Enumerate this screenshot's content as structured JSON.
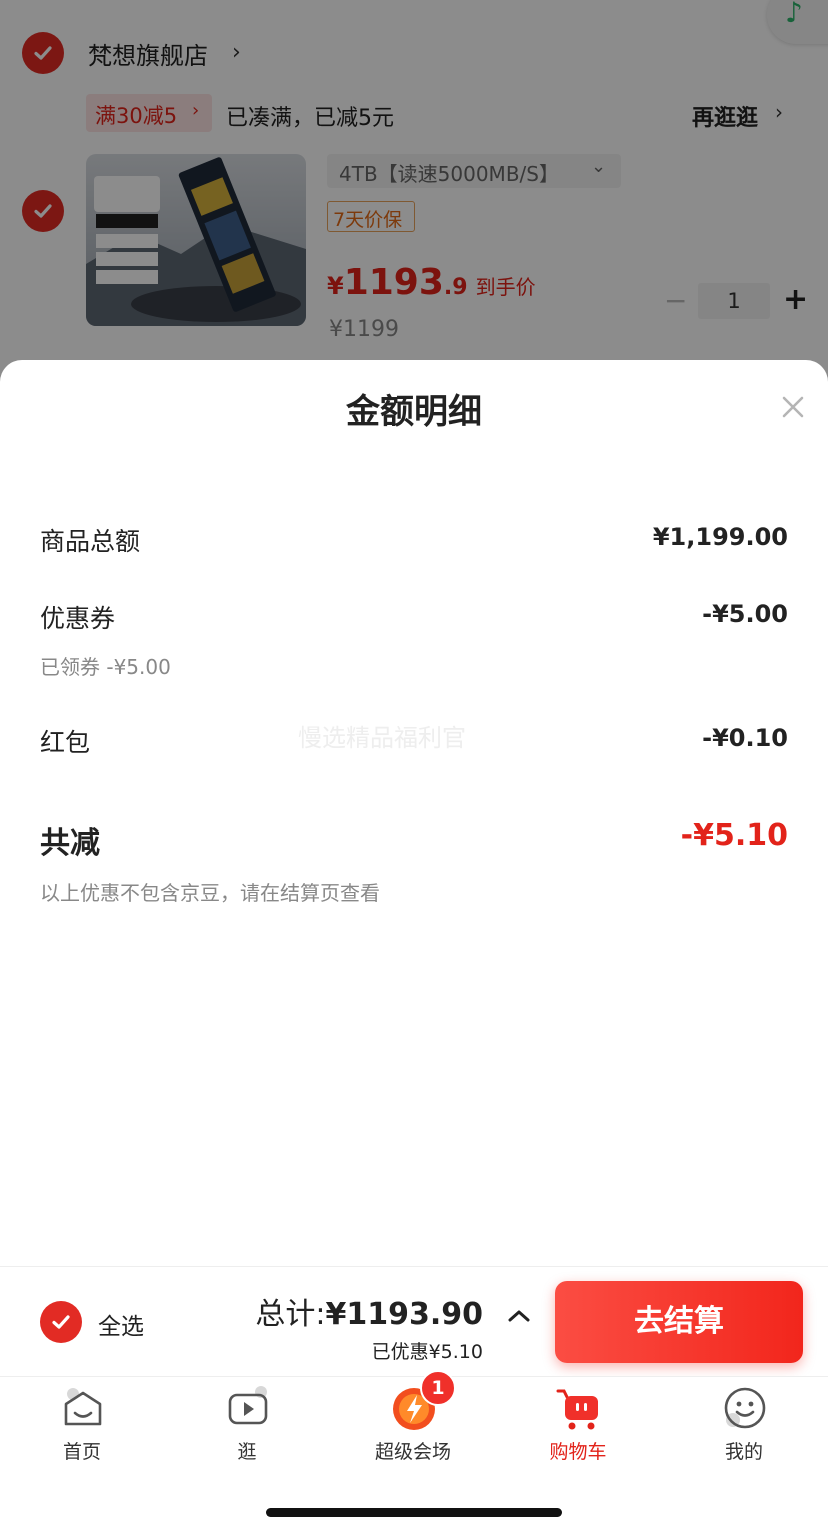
{
  "cart": {
    "store_name": "梵想旗舰店",
    "store_arrow": "›",
    "promo_tag": "满30减5",
    "promo_tag_arrow": "›",
    "promo_text": "已凑满，已减5元",
    "shop_more": "再逛逛",
    "shop_more_arrow": "›",
    "sku": "4TB【读速5000MB/S】",
    "sku_arrow": "⌄",
    "guarantee": "7天价保",
    "price_yen": "¥",
    "price_int": "1193",
    "price_dec": ".9",
    "price_tag": "到手价",
    "original_price": "¥1199",
    "qty": "1",
    "qty_minus": "−",
    "qty_plus": "+",
    "music_icon": "♪"
  },
  "sheet": {
    "title": "金额明细",
    "rows": [
      {
        "label": "商品总额",
        "value": "¥1,199.00"
      },
      {
        "label": "优惠券",
        "value": "-¥5.00",
        "note": "已领券 -¥5.00"
      },
      {
        "label": "红包",
        "value": "-¥0.10"
      }
    ],
    "watermark": "慢选精品福利官",
    "total_label": "共减",
    "total_value": "-¥5.10",
    "footnote": "以上优惠不包含京豆，请在结算页查看"
  },
  "checkout": {
    "select_all": "全选",
    "total_prefix": "总计:",
    "total_amount": "¥1193.90",
    "discount": "已优惠¥5.10",
    "button": "去结算"
  },
  "tabs": [
    {
      "label": "首页",
      "icon": "home-icon"
    },
    {
      "label": "逛",
      "icon": "video-play-icon"
    },
    {
      "label": "超级会场",
      "icon": "super-venue-icon"
    },
    {
      "label": "购物车",
      "icon": "cart-icon"
    },
    {
      "label": "我的",
      "icon": "smile-face-icon"
    }
  ],
  "badge_count": "1",
  "colors": {
    "accent_red": "#e2231a",
    "button_red": "#f2261c",
    "text_dark": "#222222",
    "text_gray": "#888888"
  }
}
